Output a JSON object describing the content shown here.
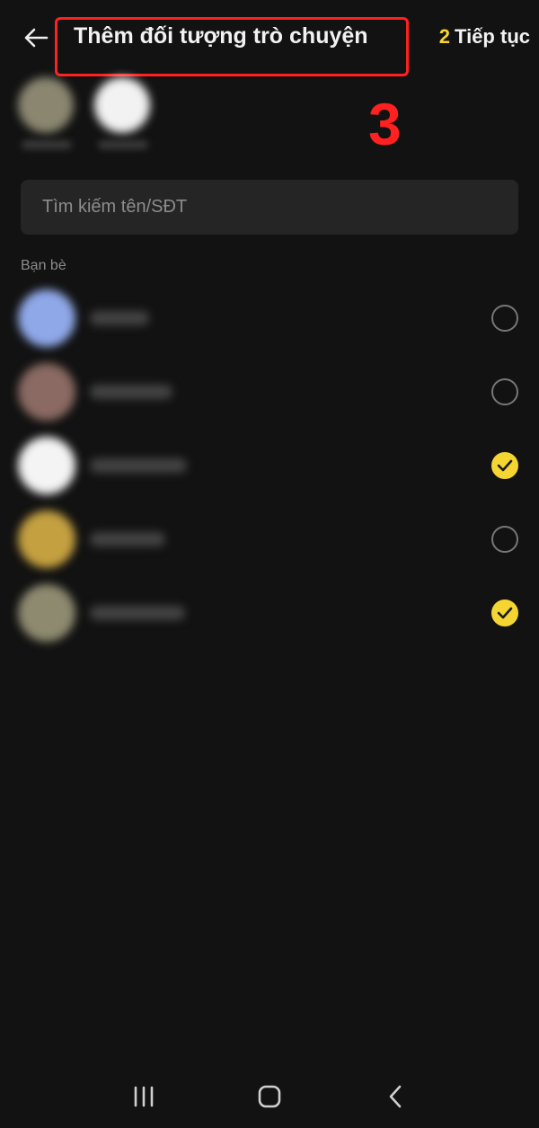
{
  "header": {
    "title": "Thêm đối tượng trò chuyện",
    "continue_count": "2",
    "continue_label": "Tiếp tục"
  },
  "annotation": {
    "step_number": "3"
  },
  "search": {
    "placeholder": "Tìm kiếm tên/SĐT"
  },
  "friends_section": {
    "label": "Bạn bè",
    "items": [
      {
        "avatar_color": "#8fa8e8",
        "selected": false
      },
      {
        "avatar_color": "#8a6a62",
        "selected": false
      },
      {
        "avatar_color": "#f4f4f4",
        "selected": true
      },
      {
        "avatar_color": "#c4a040",
        "selected": false
      },
      {
        "avatar_color": "#8e8a70",
        "selected": true
      }
    ]
  },
  "selected_strip": [
    {
      "avatar_color": "#8a8670"
    },
    {
      "avatar_color": "#f2f2f2"
    }
  ],
  "colors": {
    "background": "#121212",
    "accent": "#f5d531",
    "annotation": "#ff2020"
  },
  "navbar": {
    "icons": [
      "recent-apps-icon",
      "home-icon",
      "back-icon"
    ]
  }
}
